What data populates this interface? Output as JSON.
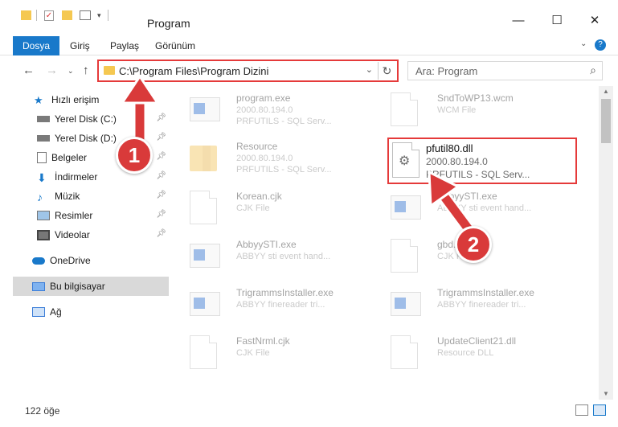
{
  "window": {
    "title": "Program",
    "controls": {
      "minimize": "—",
      "maximize": "☐",
      "close": "✕"
    }
  },
  "ribbon": {
    "tabs": [
      {
        "label": "Dosya",
        "active": true
      },
      {
        "label": "Giriş"
      },
      {
        "label": "Paylaş"
      },
      {
        "label": "Görünüm"
      }
    ],
    "expand_icon": "chevron-down-icon",
    "help_icon": "help-icon"
  },
  "nav": {
    "address_path": "C:\\Program Files\\Program Dizini",
    "search_placeholder": "Ara: Program"
  },
  "sidebar": {
    "items": [
      {
        "label": "Hızlı erişim",
        "icon": "star-icon"
      },
      {
        "label": "Yerel Disk (C:)",
        "icon": "drive-icon",
        "pinned": true
      },
      {
        "label": "Yerel Disk (D:)",
        "icon": "drive-icon",
        "pinned": true
      },
      {
        "label": "Belgeler",
        "icon": "documents-icon",
        "pinned": true
      },
      {
        "label": "İndirmeler",
        "icon": "download-icon",
        "pinned": true
      },
      {
        "label": "Müzik",
        "icon": "music-icon",
        "pinned": true
      },
      {
        "label": "Resimler",
        "icon": "pictures-icon",
        "pinned": true
      },
      {
        "label": "Videolar",
        "icon": "videos-icon",
        "pinned": true
      },
      {
        "label": "OneDrive",
        "icon": "cloud-icon"
      },
      {
        "label": "Bu bilgisayar",
        "icon": "computer-icon",
        "selected": true
      },
      {
        "label": "Ağ",
        "icon": "network-icon"
      }
    ]
  },
  "files": [
    {
      "name": "program.exe",
      "line2": "2000.80.194.0",
      "line3": "PRFUTILS - SQL Serv...",
      "type": "exe"
    },
    {
      "name": "SndToWP13.wcm",
      "line2": "WCM File",
      "line3": "",
      "type": "doc"
    },
    {
      "name": "Resource",
      "line2": "2000.80.194.0",
      "line3": "PRFUTILS - SQL Serv...",
      "type": "folder"
    },
    {
      "name": "pfutil80.dll",
      "line2": "2000.80.194.0",
      "line3": "PRFUTILS - SQL Serv...",
      "type": "dll",
      "highlight": true
    },
    {
      "name": "Korean.cjk",
      "line2": "CJK File",
      "line3": "",
      "type": "doc"
    },
    {
      "name": "AbbyySTI.exe",
      "line2": "ABBYY sti event hand...",
      "line3": "",
      "type": "app"
    },
    {
      "name": "AbbyySTI.exe",
      "line2": "ABBYY sti event hand...",
      "line3": "",
      "type": "app"
    },
    {
      "name": "gbd.cjk",
      "line2": "CJK File",
      "line3": "",
      "type": "doc"
    },
    {
      "name": "TrigrammsInstaller.exe",
      "line2": "ABBYY finereader tri...",
      "line3": "",
      "type": "app"
    },
    {
      "name": "TrigrammsInstaller.exe",
      "line2": "ABBYY finereader tri...",
      "line3": "",
      "type": "app"
    },
    {
      "name": "FastNrml.cjk",
      "line2": "CJK File",
      "line3": "",
      "type": "doc"
    },
    {
      "name": "UpdateClient21.dll",
      "line2": "Resource DLL",
      "line3": "",
      "type": "doc"
    }
  ],
  "status": {
    "item_count": "122 öğe"
  },
  "annotations": [
    {
      "label": "1"
    },
    {
      "label": "2"
    }
  ],
  "colors": {
    "accent": "#1979ca",
    "highlight": "#e53a3a",
    "badge": "#d93a3a"
  }
}
